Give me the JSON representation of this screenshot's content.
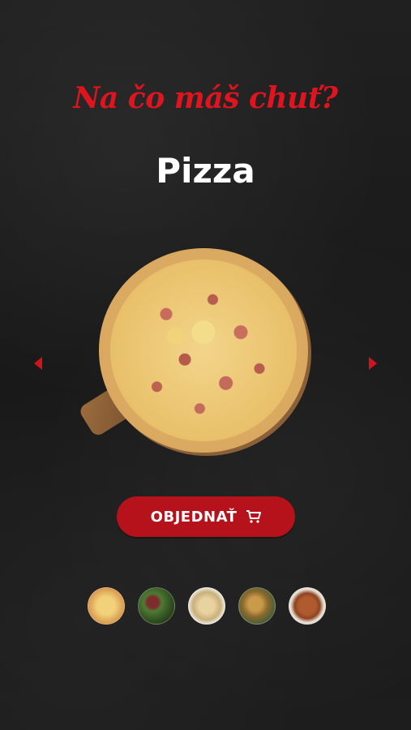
{
  "header": {
    "tagline": "Na čo máš chuť?",
    "category_title": "Pizza"
  },
  "carousel": {
    "prev_icon": "chevron-left-icon",
    "next_icon": "chevron-right-icon",
    "accent_color": "#d4121c"
  },
  "order_button": {
    "label": "OBJEDNAŤ",
    "icon": "cart-icon",
    "color": "#b5121b"
  },
  "thumbnails": [
    {
      "name": "pizza"
    },
    {
      "name": "salad"
    },
    {
      "name": "pasta"
    },
    {
      "name": "dish"
    },
    {
      "name": "soup"
    }
  ]
}
